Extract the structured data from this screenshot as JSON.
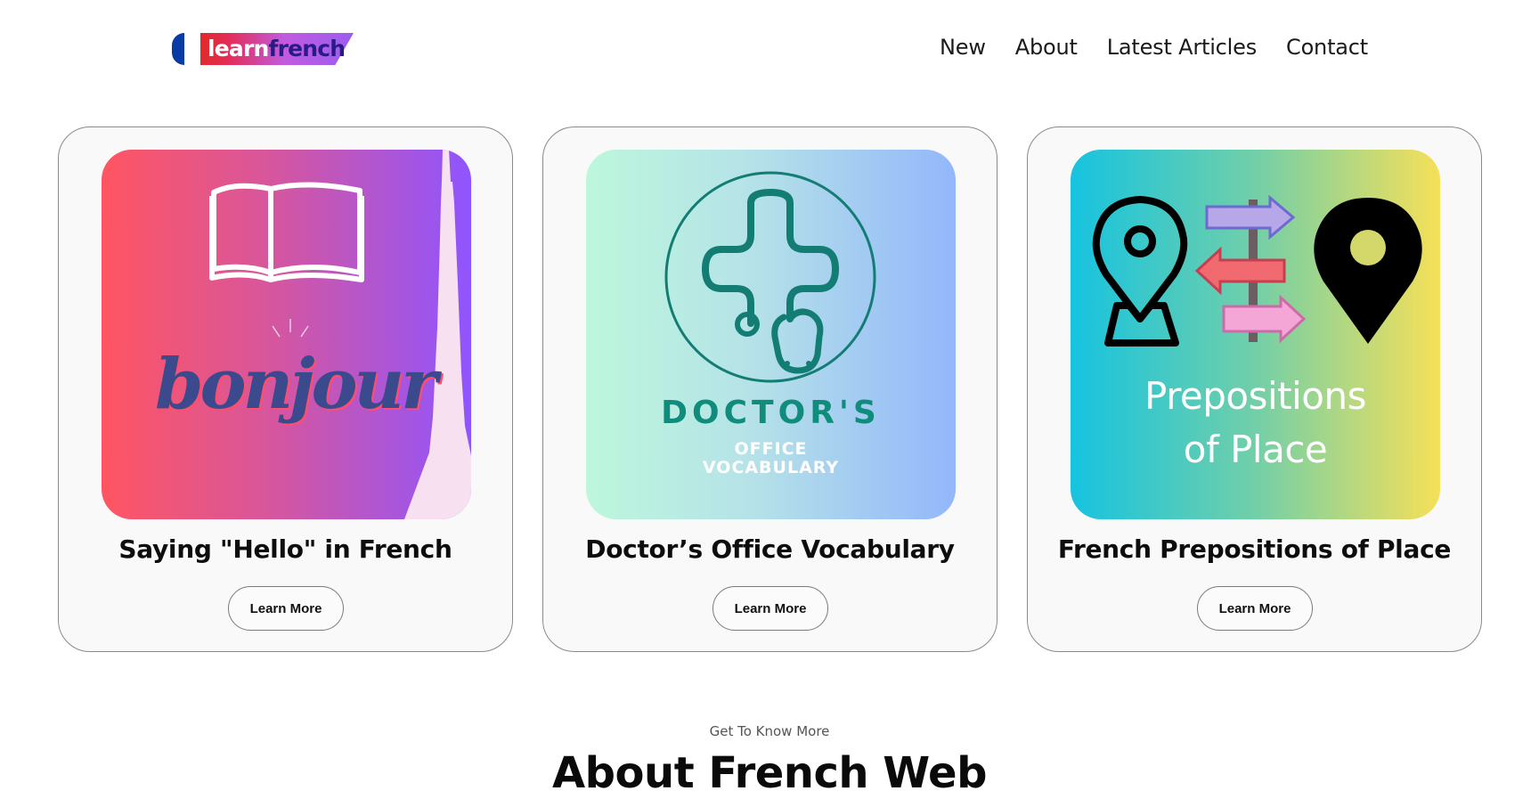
{
  "header": {
    "logo": {
      "word1": "learn",
      "word2": "french"
    },
    "nav": [
      {
        "label": "New"
      },
      {
        "label": "About"
      },
      {
        "label": "Latest Articles"
      },
      {
        "label": "Contact"
      }
    ]
  },
  "cards": [
    {
      "title": "Saying \"Hello\" in French",
      "button": "Learn More",
      "image_text": "bonjour"
    },
    {
      "title": "Doctor’s Office Vocabulary",
      "button": "Learn More",
      "image_text_big": "DOCTOR'S",
      "image_text_small": "OFFICE",
      "image_text_small2": "VOCABULARY"
    },
    {
      "title": "French Prepositions of Place",
      "button": "Learn More",
      "image_text_line1": "Prepositions",
      "image_text_line2": "of Place"
    }
  ],
  "about": {
    "kicker": "Get To Know More",
    "title": "About French Web"
  },
  "colors": {
    "flag_blue": "#0a3aa6",
    "logo_red": "#e02b2b",
    "logo_purple": "#9b5cf0",
    "card_bg": "#f9f9f9",
    "doctor_teal": "#0f8c7c"
  }
}
